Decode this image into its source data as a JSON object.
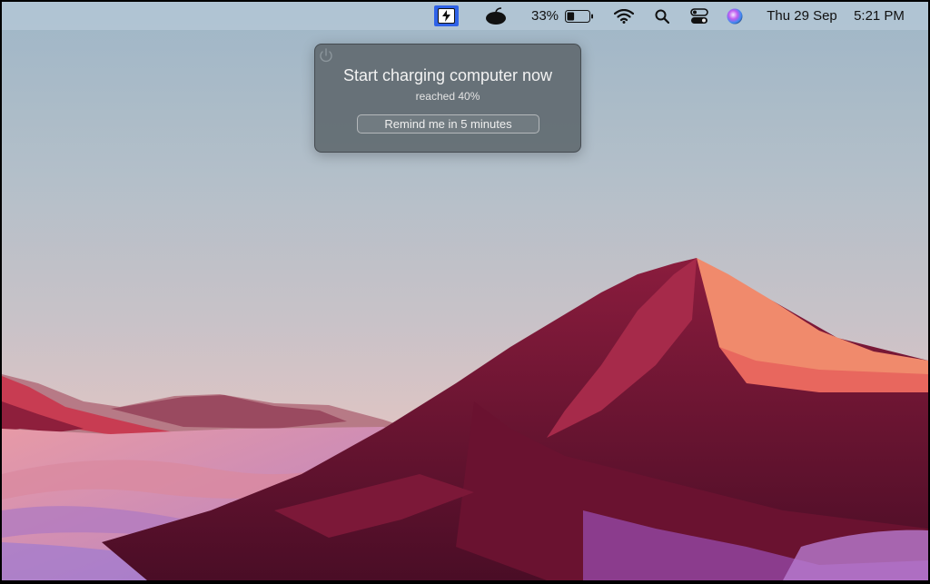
{
  "menubar": {
    "app_icon": "battery-charge-alert-icon",
    "extra_icon": "mouse-icon",
    "battery_percent": "33%",
    "battery_level": 0.33,
    "wifi_icon": "wifi-icon",
    "search_icon": "search-icon",
    "control_center_icon": "control-center-icon",
    "siri_icon": "siri-icon",
    "date": "Thu 29 Sep",
    "time": "5:21 PM"
  },
  "notification": {
    "icon": "power-icon",
    "title": "Start charging computer now",
    "subtitle": "reached 40%",
    "button_label": "Remind me in 5 minutes"
  },
  "colors": {
    "accent": "#2f62e8",
    "popup_bg": "#626c72"
  }
}
